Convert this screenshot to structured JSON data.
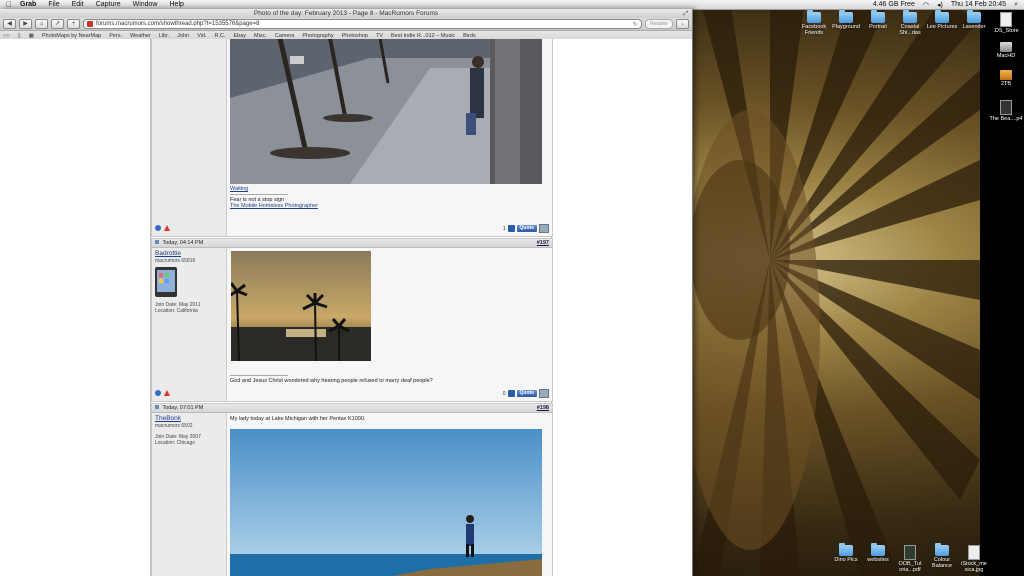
{
  "menubar": {
    "app": "Grab",
    "items": [
      "File",
      "Edit",
      "Capture",
      "Window",
      "Help"
    ],
    "status_right": [
      "4.46 GB Free",
      "Thu 14 Feb  20:45"
    ]
  },
  "browser": {
    "title": "Photo of the day: February 2013 - Page 8 - MacRumors Forums",
    "url": "forums.macrumors.com/showthread.php?t=1535576&page=8",
    "reader_label": "Reader",
    "bookmarks": [
      "PhotoMaps by NearMap",
      "Pers.",
      "Weather",
      "Libr.",
      "John",
      "Vid.",
      "R.C.",
      "Ebay",
      "Misc.",
      "Camera",
      "Photography",
      "Photoshop",
      "TV",
      "Best Indie R...012 – Music",
      "Birds"
    ]
  },
  "posts": [
    {
      "caption_link": "Waiting",
      "sig_text": "Fear is not a stop sign",
      "sig_link": "The Mobile Homeless Photographer",
      "thanks_count": "1",
      "quote_label": "Quote"
    },
    {
      "date": "Today, 04:14 PM",
      "number": "#197",
      "username": "Badrottie",
      "user_title": "macrumors 65816",
      "join_date": "Join Date: May 2011",
      "location": "Location: California",
      "message": "God and Jesus Christ wondered why hearing people refused to marry deaf people?",
      "thanks_count": "0",
      "quote_label": "Quote"
    },
    {
      "date": "Today, 07:01 PM",
      "number": "#198",
      "username": "TheBonk",
      "user_title": "macrumors 6502",
      "join_date": "Join Date: May 2007",
      "location": "Location: Chicago",
      "message": "My lady today at Lake Michigan with her Pentax K1000."
    }
  ],
  "desktop": {
    "top_icons": [
      "Facebook Friends",
      "Playground",
      "Portrait",
      "Coastal Shi...das",
      "Lee Pictures",
      "Lavender"
    ],
    "right_icons": [
      ".DS_Store",
      "MacHD",
      "2TB",
      "The Bea....p4"
    ],
    "bottom_icons": [
      "Dino Pics",
      "websites",
      "OOB_Tut oria...pdf",
      "Colour Balance",
      "iStock_me sica.jpg"
    ]
  }
}
